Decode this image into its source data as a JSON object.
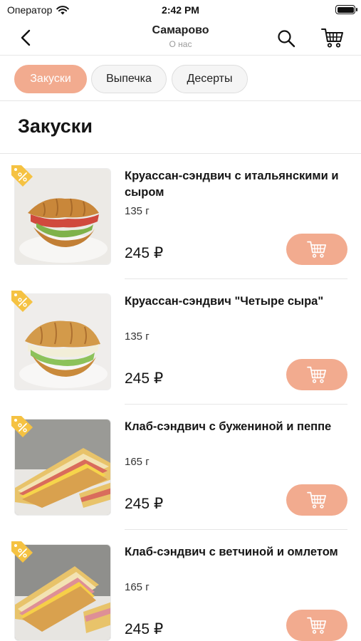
{
  "status_bar": {
    "carrier": "Оператор",
    "time": "2:42 PM"
  },
  "nav": {
    "title": "Самарово",
    "subtitle": "О нас"
  },
  "categories": [
    {
      "label": "Закуски",
      "active": true
    },
    {
      "label": "Выпечка",
      "active": false
    },
    {
      "label": "Десерты",
      "active": false
    }
  ],
  "section": {
    "title": "Закуски"
  },
  "products": [
    {
      "name": "Круассан-сэндвич с итальянскими и сыром",
      "weight": "135 г",
      "price": "245 ₽",
      "image": "croissant-sandwich-salami"
    },
    {
      "name": "Круассан-сэндвич \"Четыре сыра\"",
      "weight": "135 г",
      "price": "245 ₽",
      "image": "croissant-sandwich-cheese"
    },
    {
      "name": "Клаб-сэндвич с бужениной и пеппе",
      "weight": "165 г",
      "price": "245 ₽",
      "image": "club-sandwich-pork"
    },
    {
      "name": "Клаб-сэндвич с ветчиной и омлетом",
      "weight": "165 г",
      "price": "245 ₽",
      "image": "club-sandwich-ham-omelet"
    }
  ],
  "colors": {
    "accent": "#f2ab8f",
    "tag": "#f5c242",
    "divider": "#e6e6e6"
  },
  "icons": {
    "back": "chevron-left-icon",
    "search": "search-icon",
    "cart": "cart-icon",
    "discount": "discount-tag-icon"
  }
}
